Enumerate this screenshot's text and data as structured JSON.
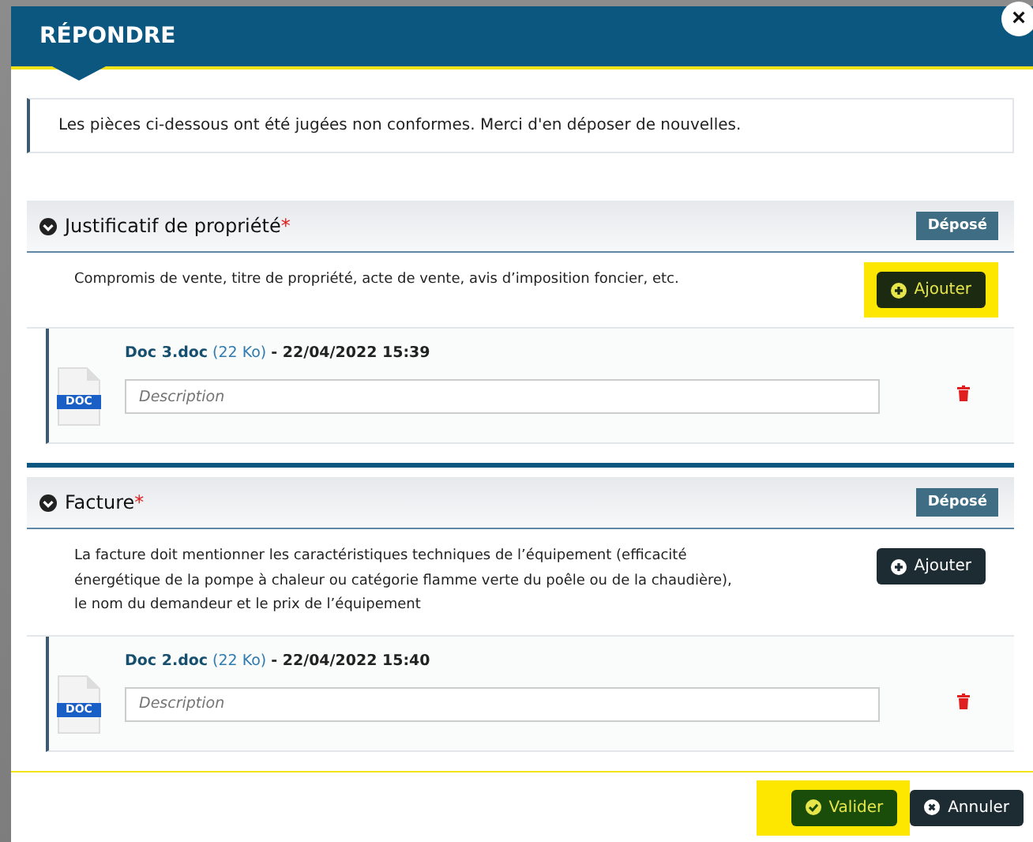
{
  "modal": {
    "title": "RÉPONDRE",
    "close": "×"
  },
  "notice": "Les pièces ci-dessous ont été jugées non conformes. Merci d'en déposer de nouvelles.",
  "sections": [
    {
      "title": "Justificatif de propriété",
      "required_mark": "*",
      "expanded": true,
      "status": "Déposé",
      "description": "Compromis de vente, titre de propriété, acte de vente, avis d’imposition foncier, etc.",
      "add_button": {
        "label": "Ajouter",
        "highlighted": true
      },
      "files": [
        {
          "name": "Doc 3.doc",
          "size": "(22 Ko)",
          "date": "- 22/04/2022 15:39",
          "icon_label": "DOC",
          "placeholder": "Description"
        }
      ]
    },
    {
      "title": "Facture",
      "required_mark": "*",
      "expanded": true,
      "status": "Déposé",
      "description": "La facture doit mentionner les caractéristiques techniques de l’équipement (efficacité énergétique de la pompe à chaleur ou catégorie flamme verte du poêle ou de la chaudière), le nom du demandeur et le prix de l’équipement",
      "add_button": {
        "label": "Ajouter",
        "highlighted": false
      },
      "files": [
        {
          "name": "Doc 2.doc",
          "size": "(22 Ko)",
          "date": "- 22/04/2022 15:40",
          "icon_label": "DOC",
          "placeholder": "Description"
        }
      ]
    }
  ],
  "footer": {
    "validate": {
      "label": "Valider",
      "highlighted": true
    },
    "cancel": {
      "label": "Annuler",
      "highlighted": false
    }
  }
}
